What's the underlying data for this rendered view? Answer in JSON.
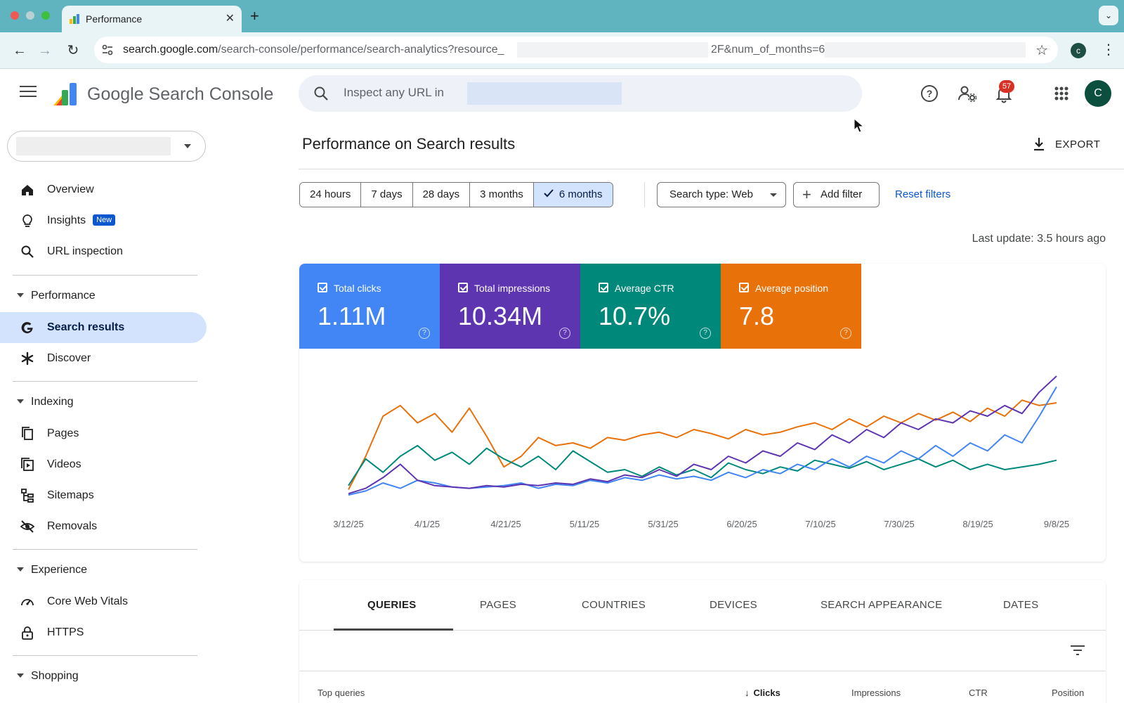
{
  "browser": {
    "tab_title": "Performance",
    "tab_close": "✕",
    "new_tab": "+",
    "url_host": "search.google.com",
    "url_path": "/search-console/performance/search-analytics?resource_",
    "url_tail": "2F&num_of_months=6",
    "profile_initial": "c"
  },
  "header": {
    "brand": "Google Search Console",
    "inspect_placeholder": "Inspect any URL in",
    "notification_count": "57",
    "avatar_initial": "C"
  },
  "sidebar": {
    "items": [
      {
        "label": "Overview"
      },
      {
        "label": "Insights",
        "badge": "New"
      },
      {
        "label": "URL inspection"
      }
    ],
    "sections": {
      "performance": {
        "label": "Performance",
        "items": [
          {
            "label": "Search results"
          },
          {
            "label": "Discover"
          }
        ]
      },
      "indexing": {
        "label": "Indexing",
        "items": [
          {
            "label": "Pages"
          },
          {
            "label": "Videos"
          },
          {
            "label": "Sitemaps"
          },
          {
            "label": "Removals"
          }
        ]
      },
      "experience": {
        "label": "Experience",
        "items": [
          {
            "label": "Core Web Vitals"
          },
          {
            "label": "HTTPS"
          }
        ]
      },
      "shopping": {
        "label": "Shopping"
      }
    }
  },
  "main": {
    "title": "Performance on Search results",
    "export_label": "EXPORT",
    "date_ranges": [
      "24 hours",
      "7 days",
      "28 days",
      "3 months",
      "6 months"
    ],
    "selected_range": "6 months",
    "search_type": "Search type: Web",
    "add_filter": "Add filter",
    "reset_filters": "Reset filters",
    "last_update": "Last update: 3.5 hours ago",
    "metrics": [
      {
        "label": "Total clicks",
        "value": "1.11M",
        "color": "#4285f4"
      },
      {
        "label": "Total impressions",
        "value": "10.34M",
        "color": "#5e35b1"
      },
      {
        "label": "Average CTR",
        "value": "10.7%",
        "color": "#00897b"
      },
      {
        "label": "Average position",
        "value": "7.8",
        "color": "#e8710a"
      }
    ],
    "tabs": [
      "QUERIES",
      "PAGES",
      "COUNTRIES",
      "DEVICES",
      "SEARCH APPEARANCE",
      "DATES"
    ],
    "active_tab": "QUERIES",
    "table_headers": {
      "query": "Top queries",
      "clicks": "Clicks",
      "impressions": "Impressions",
      "ctr": "CTR",
      "position": "Position"
    }
  },
  "chart_data": {
    "type": "line",
    "x_ticks": [
      "3/12/25",
      "4/1/25",
      "4/21/25",
      "5/11/25",
      "5/31/25",
      "6/20/25",
      "7/10/25",
      "7/30/25",
      "8/19/25",
      "9/8/25"
    ],
    "grid": false,
    "legend": "none",
    "series": [
      {
        "name": "Average position",
        "color": "#e8710a",
        "values": [
          0.05,
          0.3,
          0.6,
          0.68,
          0.55,
          0.62,
          0.48,
          0.66,
          0.45,
          0.22,
          0.3,
          0.44,
          0.38,
          0.4,
          0.36,
          0.44,
          0.42,
          0.46,
          0.48,
          0.44,
          0.5,
          0.47,
          0.43,
          0.5,
          0.46,
          0.48,
          0.52,
          0.55,
          0.5,
          0.58,
          0.52,
          0.6,
          0.55,
          0.62,
          0.57,
          0.63,
          0.56,
          0.66,
          0.6,
          0.72,
          0.68,
          0.7
        ]
      },
      {
        "name": "Average CTR",
        "color": "#00897b",
        "values": [
          0.08,
          0.28,
          0.18,
          0.3,
          0.38,
          0.27,
          0.33,
          0.24,
          0.36,
          0.28,
          0.22,
          0.3,
          0.2,
          0.34,
          0.26,
          0.18,
          0.2,
          0.15,
          0.22,
          0.16,
          0.2,
          0.14,
          0.25,
          0.2,
          0.17,
          0.22,
          0.19,
          0.27,
          0.24,
          0.21,
          0.26,
          0.2,
          0.24,
          0.28,
          0.22,
          0.27,
          0.2,
          0.24,
          0.2,
          0.22,
          0.24,
          0.27
        ]
      },
      {
        "name": "Total clicks",
        "color": "#4285f4",
        "values": [
          0.01,
          0.04,
          0.1,
          0.06,
          0.12,
          0.1,
          0.07,
          0.06,
          0.07,
          0.08,
          0.1,
          0.06,
          0.09,
          0.08,
          0.12,
          0.1,
          0.14,
          0.12,
          0.16,
          0.13,
          0.15,
          0.12,
          0.18,
          0.14,
          0.2,
          0.17,
          0.24,
          0.2,
          0.28,
          0.22,
          0.3,
          0.25,
          0.34,
          0.28,
          0.38,
          0.3,
          0.4,
          0.34,
          0.46,
          0.4,
          0.6,
          0.82
        ]
      },
      {
        "name": "Total impressions",
        "color": "#5e35b1",
        "values": [
          0.02,
          0.06,
          0.14,
          0.24,
          0.12,
          0.08,
          0.07,
          0.06,
          0.08,
          0.07,
          0.09,
          0.08,
          0.1,
          0.09,
          0.13,
          0.11,
          0.16,
          0.14,
          0.2,
          0.15,
          0.24,
          0.2,
          0.3,
          0.25,
          0.34,
          0.3,
          0.4,
          0.35,
          0.46,
          0.4,
          0.5,
          0.44,
          0.55,
          0.5,
          0.58,
          0.55,
          0.64,
          0.6,
          0.68,
          0.62,
          0.78,
          0.9
        ]
      }
    ]
  }
}
